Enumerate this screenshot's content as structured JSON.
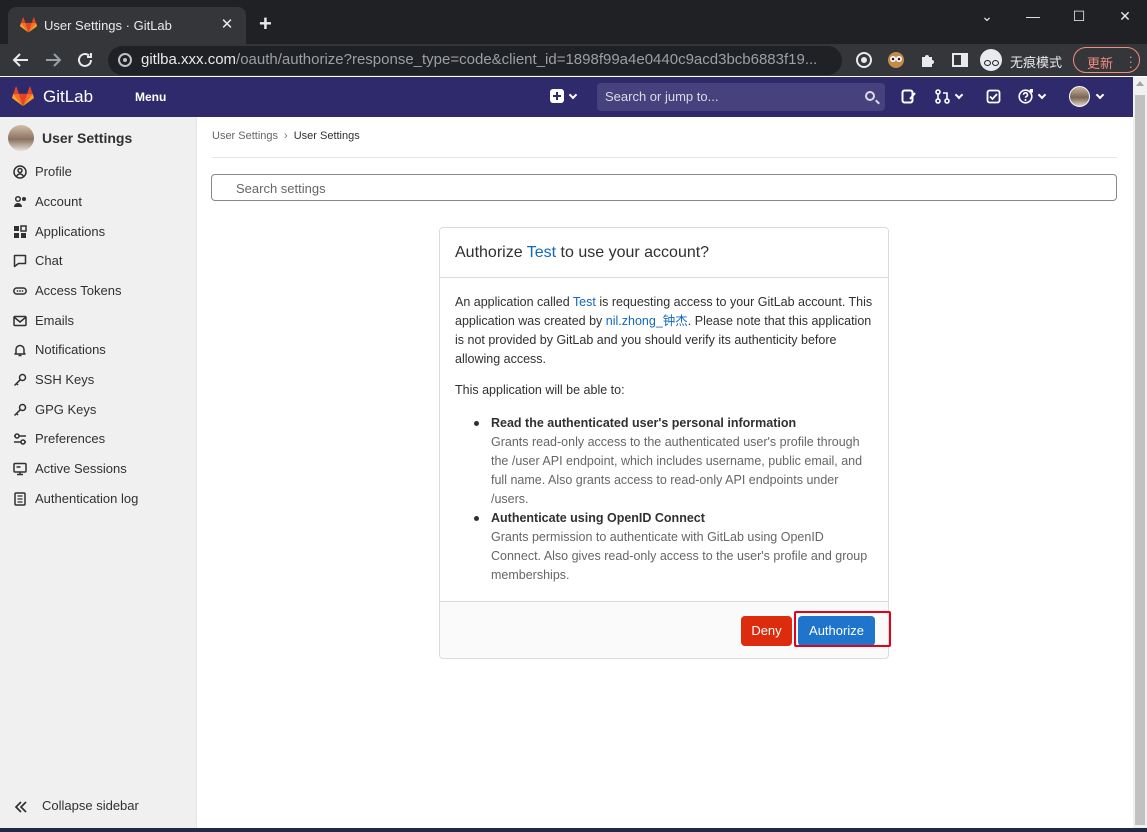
{
  "browser": {
    "tab_title": "User Settings · GitLab",
    "tab_close": "✕",
    "new_tab": "+",
    "url_host": "gitlba.xxx.com",
    "url_path": "/oauth/authorize?response_type=code&client_id=1898f99a4e0440c9acd3bcb6883f19...",
    "incognito_label": "无痕模式",
    "update_label": "更新",
    "window_controls": {
      "minimize": "—",
      "maximize": "☐",
      "close": "✕",
      "restore": "⌄"
    }
  },
  "gitlab_nav": {
    "brand": "GitLab",
    "menu_label": "Menu",
    "search_placeholder": "Search or jump to..."
  },
  "sidebar": {
    "title": "User Settings",
    "items": [
      {
        "label": "Profile",
        "icon": "profile-icon"
      },
      {
        "label": "Account",
        "icon": "account-icon"
      },
      {
        "label": "Applications",
        "icon": "applications-icon"
      },
      {
        "label": "Chat",
        "icon": "chat-icon"
      },
      {
        "label": "Access Tokens",
        "icon": "token-icon"
      },
      {
        "label": "Emails",
        "icon": "mail-icon"
      },
      {
        "label": "Notifications",
        "icon": "bell-icon"
      },
      {
        "label": "SSH Keys",
        "icon": "key-icon"
      },
      {
        "label": "GPG Keys",
        "icon": "key-icon"
      },
      {
        "label": "Preferences",
        "icon": "preferences-icon"
      },
      {
        "label": "Active Sessions",
        "icon": "monitor-icon"
      },
      {
        "label": "Authentication log",
        "icon": "log-icon"
      }
    ],
    "collapse_label": "Collapse sidebar"
  },
  "breadcrumb": {
    "first": "User Settings",
    "separator": "›",
    "current": "User Settings"
  },
  "settings_search_placeholder": "Search settings",
  "authorize": {
    "title_prefix": "Authorize ",
    "app_name": "Test",
    "title_suffix": " to use your account?",
    "intro_1": "An application called ",
    "intro_2": " is requesting access to your GitLab account. This application was created by ",
    "creator": "nil.zhong_钟杰",
    "intro_3": ". Please note that this application is not provided by GitLab and you should verify its authenticity before allowing access.",
    "able_to": "This application will be able to:",
    "scopes": [
      {
        "title": "Read the authenticated user's personal information",
        "desc": "Grants read-only access to the authenticated user's profile through the /user API endpoint, which includes username, public email, and full name. Also grants access to read-only API endpoints under /users."
      },
      {
        "title": "Authenticate using OpenID Connect",
        "desc": "Grants permission to authenticate with GitLab using OpenID Connect. Also gives read-only access to the user's profile and group memberships."
      }
    ],
    "deny_label": "Deny",
    "authorize_label": "Authorize"
  },
  "colors": {
    "nav_bg": "#2f2a6b",
    "link": "#1068bf",
    "deny": "#dd2b0e",
    "authorize": "#1f75cb",
    "highlight": "#e3001b"
  }
}
